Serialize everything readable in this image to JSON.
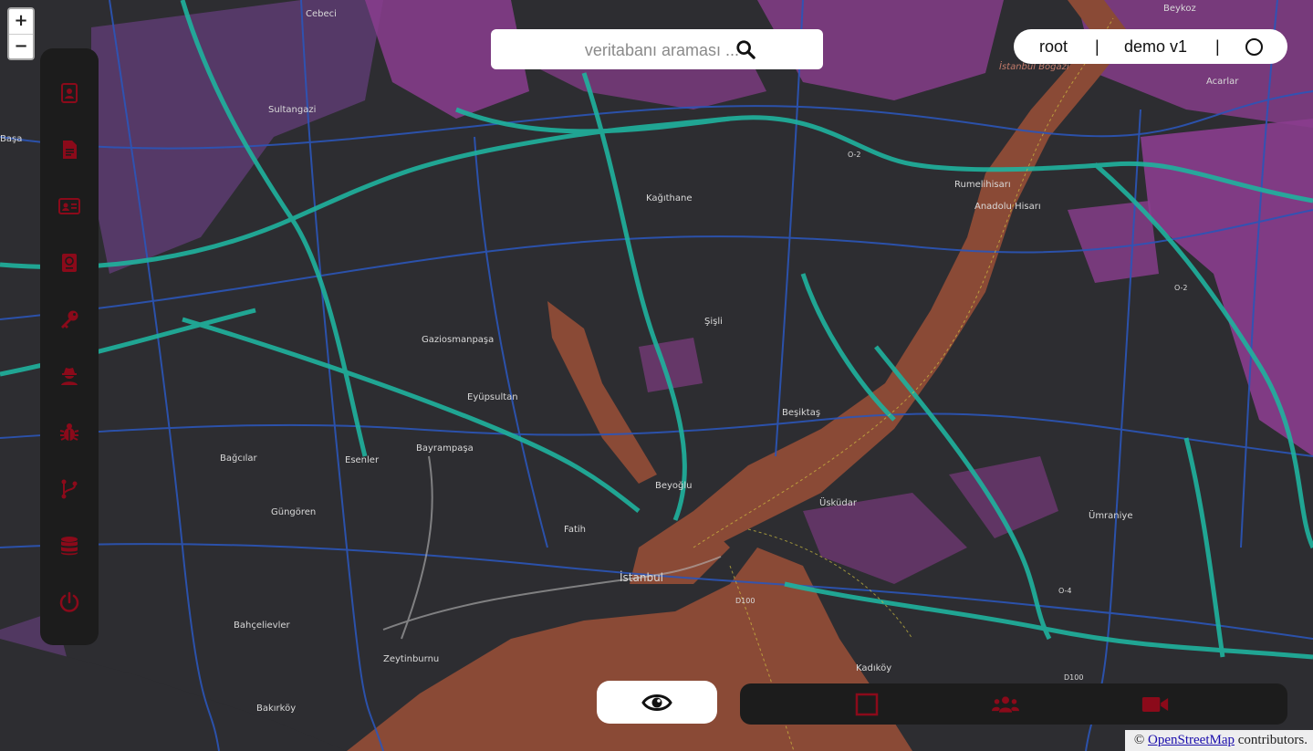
{
  "map": {
    "zoom_in": "+",
    "zoom_out": "−",
    "labels": {
      "beykoz": "Beykoz",
      "cebeci": "Cebeci",
      "istanbul_bogazi": "İstanbul Boğazı",
      "acarlar": "Acarlar",
      "sultangazi": "Sultangazi",
      "kagithane": "Kağıthane",
      "rumelihisari": "Rumelihisarı",
      "anadolu_hisari": "Anadolu Hisarı",
      "gaziosmanpasa": "Gaziosmanpaşa",
      "sisli": "Şişli",
      "eyupsultan": "Eyüpsultan",
      "besiktas": "Beşiktaş",
      "bagcilar": "Bağcılar",
      "esenler": "Esenler",
      "bayrampasa": "Bayrampaşa",
      "beyoglu": "Beyoğlu",
      "uskudar": "Üsküdar",
      "umraniye": "Ümraniye",
      "gungoren": "Güngören",
      "fatih": "Fatih",
      "istanbul": "İstanbul",
      "bahcelievler": "Bahçelievler",
      "zeytinburnu": "Zeytinburnu",
      "kadikoy": "Kadıköy",
      "bakirkoy": "Bakırköy",
      "basa": "Başa",
      "d100_west": "D100",
      "d100_east": "D100",
      "o2": "O-2",
      "o4": "O-4"
    }
  },
  "search": {
    "placeholder": "veritabanı araması ..."
  },
  "userbar": {
    "user": "root",
    "sep1": "|",
    "version": "demo v1",
    "sep2": "|"
  },
  "attribution": {
    "prefix": "©",
    "link": "OpenStreetMap",
    "suffix": "contributors."
  },
  "sidebar": {
    "items": [
      {
        "icon": "contact-book-icon"
      },
      {
        "icon": "file-icon"
      },
      {
        "icon": "id-card-icon"
      },
      {
        "icon": "passport-icon"
      },
      {
        "icon": "key-icon"
      },
      {
        "icon": "user-secret-icon"
      },
      {
        "icon": "bug-icon"
      },
      {
        "icon": "code-branch-icon"
      },
      {
        "icon": "database-icon"
      },
      {
        "icon": "power-icon"
      }
    ]
  },
  "bottombar": {
    "items": [
      {
        "icon": "square-icon"
      },
      {
        "icon": "users-icon"
      },
      {
        "icon": "video-camera-icon"
      }
    ]
  },
  "colors": {
    "accent": "#8b0a1a",
    "panel": "#1c1c1c",
    "water": "#8a4a36",
    "park": "#7a3a7a",
    "road_primary": "#1fb29e",
    "road_secondary": "#2b55b8"
  }
}
